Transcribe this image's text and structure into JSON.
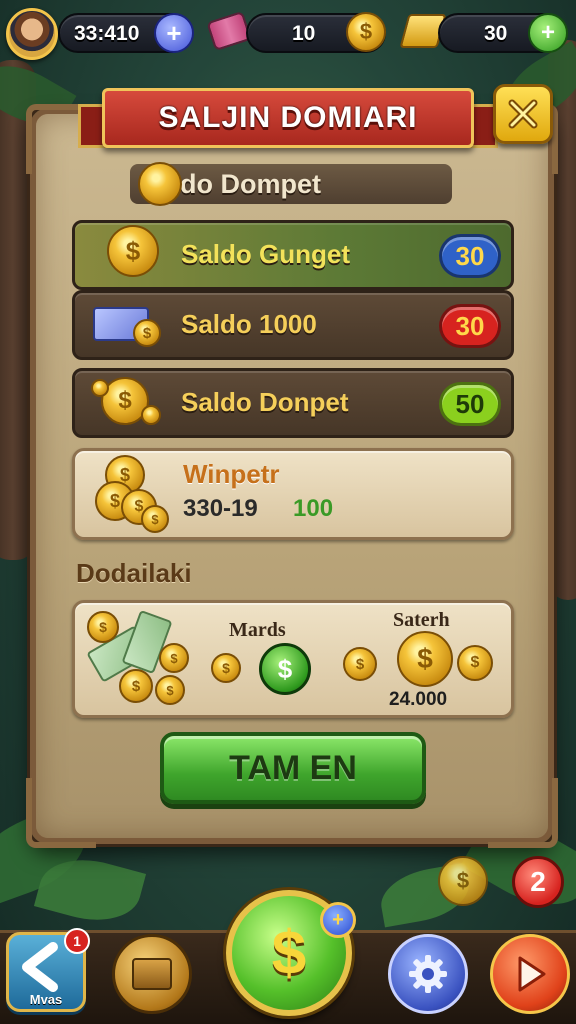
{
  "top_bar": {
    "coins_value": "33:410",
    "plus_symbol": "+",
    "tickets_value": "10",
    "currency_symbol": "$",
    "gems_value": "30",
    "gems_plus_symbol": "+"
  },
  "dialog": {
    "title": "SALJIN DOMIARI",
    "subtitle": "do Dompet",
    "rows": [
      {
        "label": "Saldo Gunget",
        "badge": "30",
        "badge_color": "#2f62c8"
      },
      {
        "label": "Saldo 1000",
        "badge": "30",
        "badge_color": "#d7231f"
      },
      {
        "label": "Saldo Donpet",
        "badge": "50",
        "badge_color": "#8bd01e"
      }
    ],
    "winner_card": {
      "title": "Winpetr",
      "value_a": "330-19",
      "value_b": "100"
    },
    "section_label": "Dodailaki",
    "rewards_card": {
      "label_left": "Mards",
      "label_right": "Saterh",
      "amount": "24.000",
      "coin_symbol": "$"
    },
    "cta_label": "TAM EN"
  },
  "side": {
    "notification_count": "2",
    "coin_symbol": "$"
  },
  "bottom_nav": {
    "back_label": "Mvas",
    "back_badge": "1",
    "center_symbol": "$",
    "center_badge_symbol": "+"
  },
  "colors": {
    "accent_red": "#d64a3c",
    "accent_gold": "#f5c43a",
    "accent_green": "#3fa52c",
    "panel": "#b9a479"
  },
  "icons": [
    "avatar",
    "ticket-icon",
    "gold-bar-icon",
    "close-icon",
    "coin-icon",
    "cash-icon",
    "gear-icon",
    "play-icon",
    "back-arrow-icon",
    "shop-icon"
  ]
}
